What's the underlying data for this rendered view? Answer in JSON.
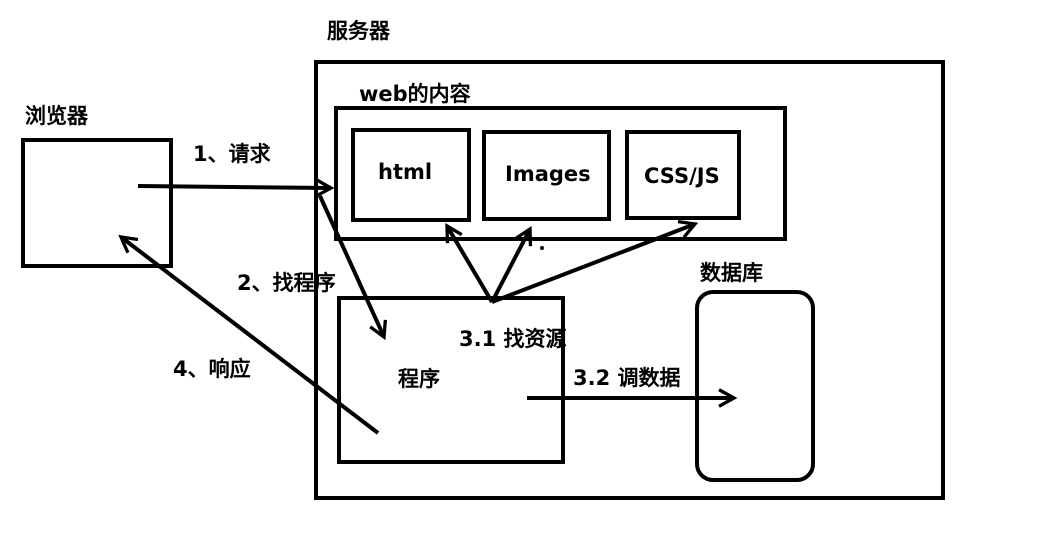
{
  "labels": {
    "server": "服务器",
    "browser": "浏览器",
    "web_content": "web的内容",
    "html": "html",
    "images": "Images",
    "css_js": "CSS/JS",
    "database": "数据库",
    "program": "程序",
    "step_request": "1、请求",
    "step_find_program": "2、找程序",
    "step_find_resource": "3.1 找资源",
    "step_fetch_data": "3.2 调数据",
    "step_response": "4、响应"
  },
  "colors": {
    "stroke": "#000000",
    "background": "#ffffff",
    "text": "#000000"
  }
}
